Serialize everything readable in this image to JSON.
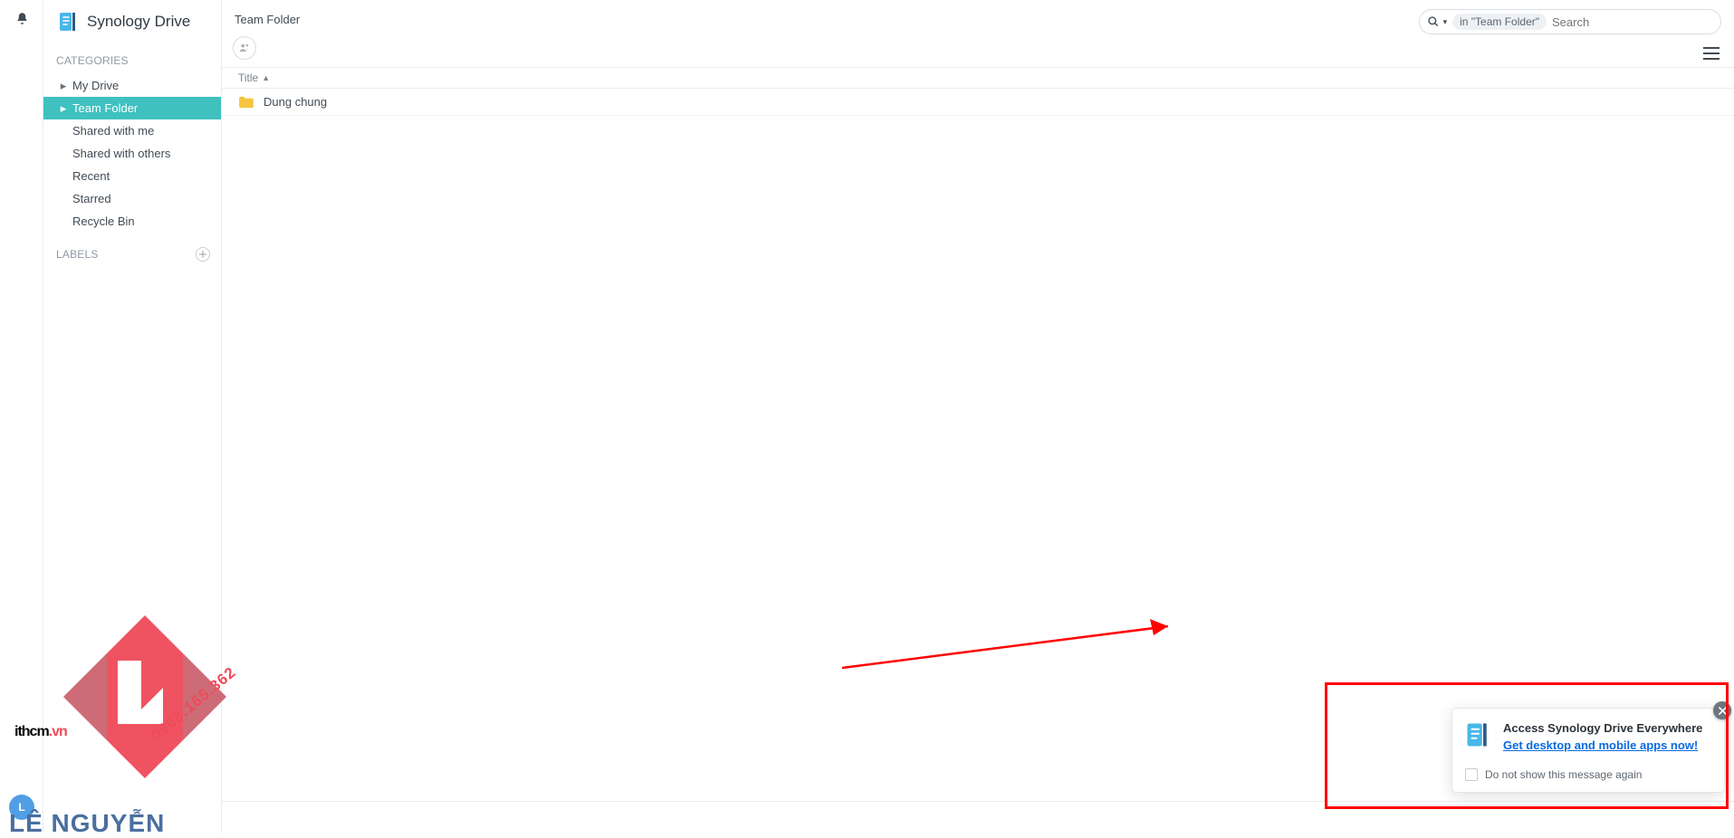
{
  "app": {
    "title": "Synology Drive"
  },
  "sidebar": {
    "section_categories": "CATEGORIES",
    "section_labels": "LABELS",
    "items": [
      {
        "label": "My Drive"
      },
      {
        "label": "Team Folder"
      },
      {
        "label": "Shared with me"
      },
      {
        "label": "Shared with others"
      },
      {
        "label": "Recent"
      },
      {
        "label": "Starred"
      },
      {
        "label": "Recycle Bin"
      }
    ]
  },
  "header": {
    "breadcrumb": "Team Folder",
    "search_scope": "in \"Team Folder\"",
    "search_placeholder": "Search"
  },
  "list": {
    "column_title": "Title",
    "rows": [
      {
        "name": "Dung chung"
      }
    ]
  },
  "promo": {
    "title": "Access Synology Drive Everywhere",
    "link": "Get desktop and mobile apps now!",
    "checkbox": "Do not show this message again"
  },
  "avatar_initial": "L",
  "watermark": {
    "domain_a": "ithcm",
    "domain_b": ".vn",
    "phone": "0908.165.362",
    "brand": "LÊ NGUYỄN"
  }
}
